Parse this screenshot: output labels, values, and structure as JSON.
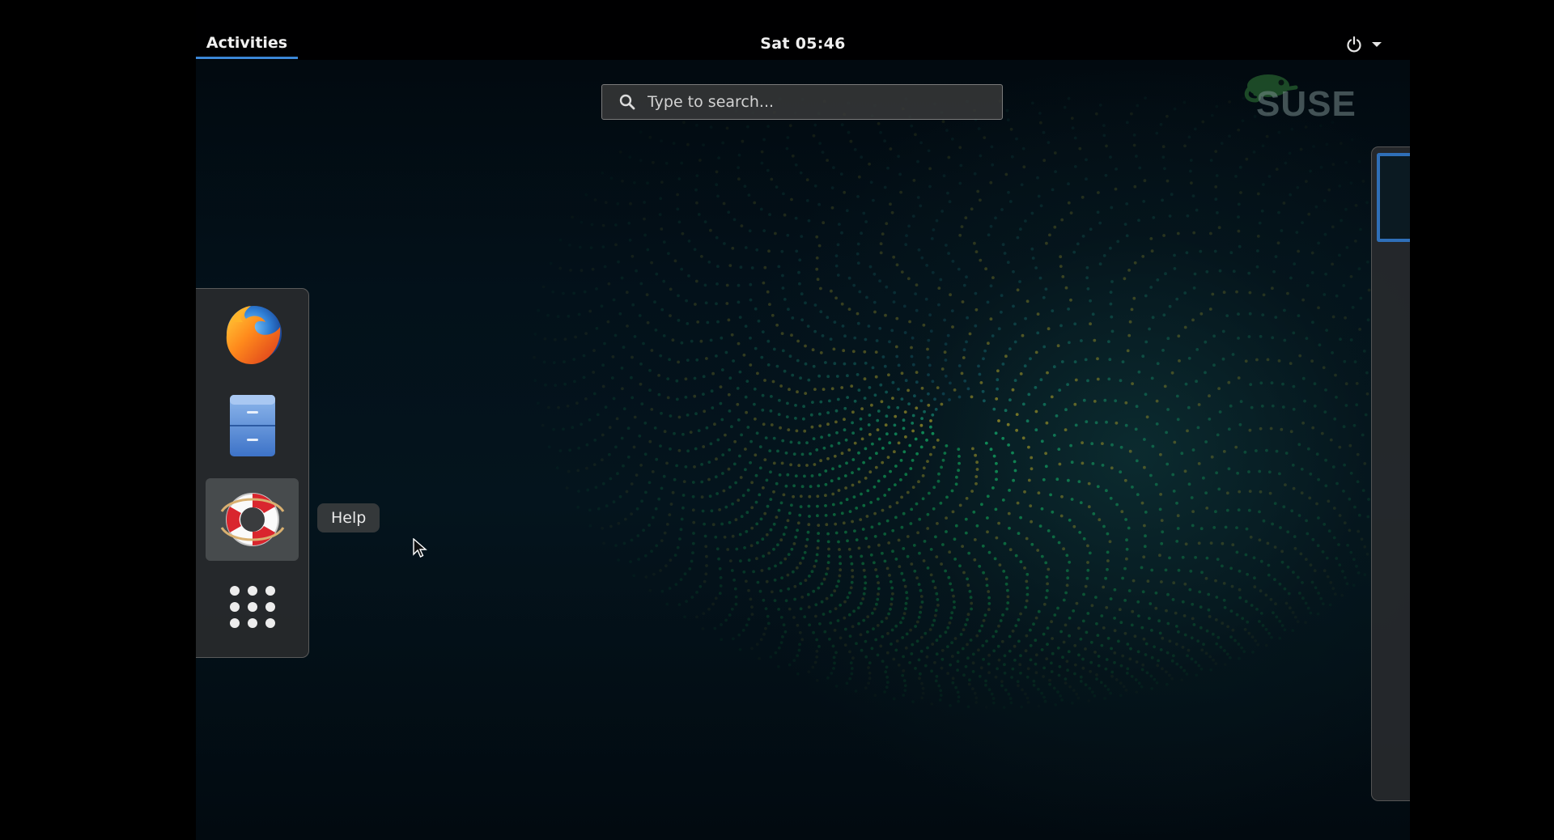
{
  "topbar": {
    "activities_label": "Activities",
    "clock": "Sat 05:46"
  },
  "search": {
    "placeholder": "Type to search..."
  },
  "branding": {
    "logo_text": "SUSE"
  },
  "dash": {
    "items": [
      {
        "name": "Firefox",
        "icon": "firefox-icon"
      },
      {
        "name": "Files",
        "icon": "file-cabinet-icon"
      },
      {
        "name": "Help",
        "icon": "lifebuoy-icon"
      },
      {
        "name": "Show Applications",
        "icon": "app-grid-icon"
      }
    ],
    "tooltip": "Help"
  },
  "workspaces": {
    "count": 1
  },
  "colors": {
    "accent": "#3b86d6",
    "workspace_active": "#2f6fb8",
    "suse_green": "#2c7a3a"
  }
}
